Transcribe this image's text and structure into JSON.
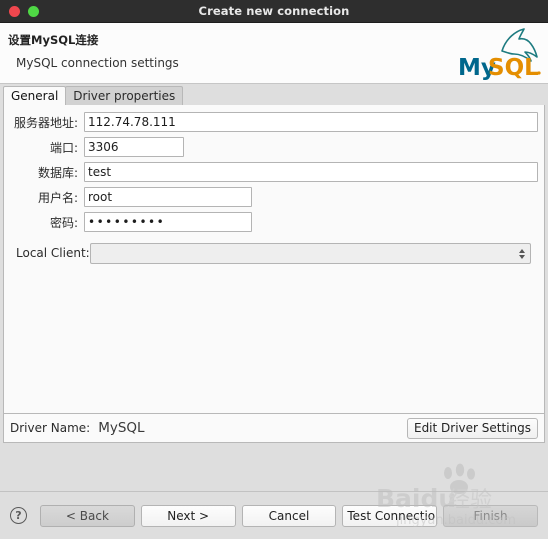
{
  "window": {
    "title": "Create new connection",
    "buttons": [
      {
        "name": "close",
        "color": "#f0474e"
      },
      {
        "name": "maximize",
        "color": "#4fd845"
      }
    ]
  },
  "header": {
    "title": "设置MySQL连接",
    "subtitle": "MySQL connection settings",
    "logo": {
      "text_my": "My",
      "text_sql": "SQL",
      "color_my": "#00678c",
      "color_sql": "#e48e00",
      "dolphin_color": "#1d7b80"
    }
  },
  "tabs": [
    {
      "label": "General",
      "active": true
    },
    {
      "label": "Driver properties",
      "active": false
    }
  ],
  "form": {
    "fields": [
      {
        "label": "服务器地址:",
        "value": "112.74.78.111",
        "type": "text",
        "name": "host"
      },
      {
        "label": "端口:",
        "value": "3306",
        "type": "text",
        "name": "port"
      },
      {
        "label": "数据库:",
        "value": "test",
        "type": "text",
        "name": "database"
      },
      {
        "label": "用户名:",
        "value": "root",
        "type": "text",
        "name": "username"
      },
      {
        "label": "密码:",
        "value": "•••••••••",
        "type": "password",
        "name": "password"
      }
    ],
    "local_client": {
      "label": "Local Client:",
      "value": "",
      "name": "local-client"
    }
  },
  "driver": {
    "label": "Driver Name:",
    "value": "MySQL",
    "edit_button": "Edit Driver Settings"
  },
  "footer": {
    "help": "?",
    "buttons": [
      {
        "label": "< Back",
        "name": "back",
        "disabled": true
      },
      {
        "label": "Next >",
        "name": "next",
        "disabled": false
      },
      {
        "label": "Cancel",
        "name": "cancel",
        "disabled": false
      },
      {
        "label": "Test Connection ...",
        "name": "test-connection",
        "disabled": false
      },
      {
        "label": "Finish",
        "name": "finish",
        "disabled": true
      }
    ]
  },
  "watermark": {
    "brand": "Baidu",
    "suffix": "经验",
    "url": "jingyan.baidu.com"
  },
  "colors": {
    "dialog_bg": "#dedede",
    "panel_bg": "#fafafa",
    "titlebar_bg": "#2e2e2e",
    "border": "#b8b8b8"
  }
}
